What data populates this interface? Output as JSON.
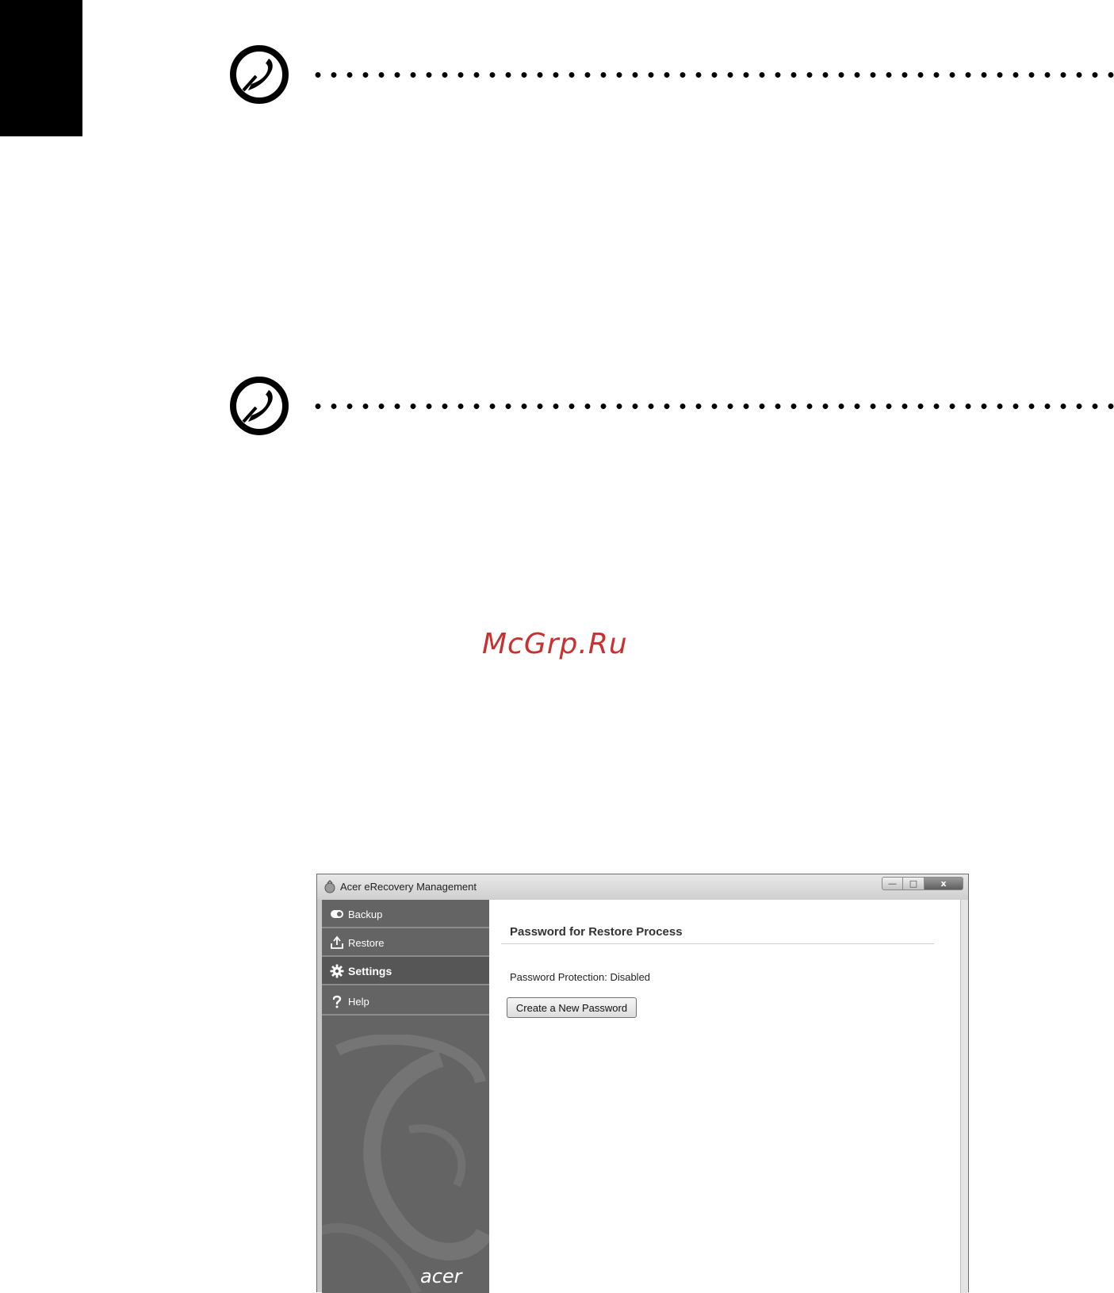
{
  "page": {
    "watermark": "McGrp.Ru"
  },
  "notes": [
    {
      "icon": "note-pen-icon"
    },
    {
      "icon": "note-pen-icon"
    }
  ],
  "window": {
    "title": "Acer eRecovery Management",
    "caption_buttons": {
      "minimize": "—",
      "maximize": "□",
      "close": "x"
    },
    "sidebar": {
      "items": [
        {
          "label": "Backup",
          "icon": "backup-icon",
          "active": false
        },
        {
          "label": "Restore",
          "icon": "restore-icon",
          "active": false
        },
        {
          "label": "Settings",
          "icon": "gear-icon",
          "active": true
        },
        {
          "label": "Help",
          "icon": "question-mark-icon",
          "active": false
        }
      ],
      "brand": "acer"
    },
    "content": {
      "section_title": "Password for Restore Process",
      "status_text": "Password Protection: Disabled",
      "create_button_label": "Create a New Password"
    }
  }
}
